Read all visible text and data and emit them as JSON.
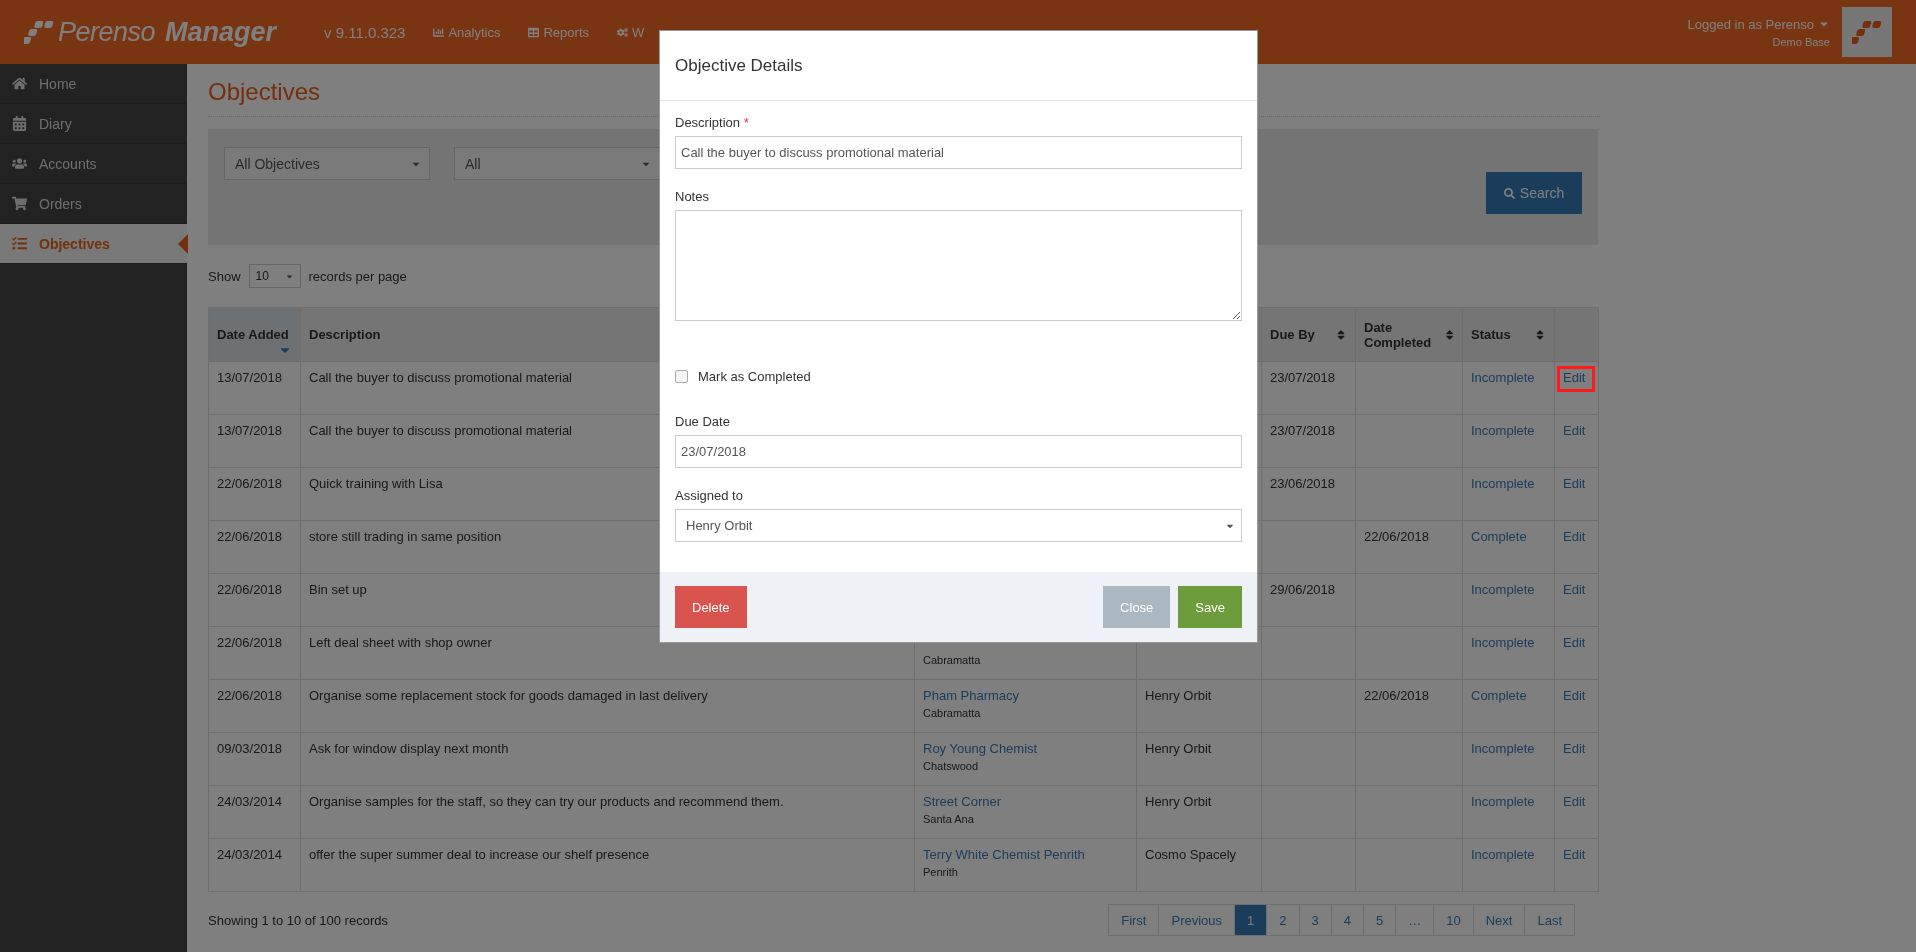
{
  "header": {
    "logo": {
      "brand": "Perenso",
      "product": "Manager"
    },
    "version": "v 9.11.0.323",
    "nav": [
      {
        "label": "Analytics"
      },
      {
        "label": "Reports"
      },
      {
        "label": "W"
      }
    ],
    "user": {
      "logged_in": "Logged in as Perenso",
      "site": "Demo Base"
    }
  },
  "sidebar": {
    "items": [
      {
        "label": "Home",
        "selected": false
      },
      {
        "label": "Diary",
        "selected": false
      },
      {
        "label": "Accounts",
        "selected": false
      },
      {
        "label": "Orders",
        "selected": false
      },
      {
        "label": "Objectives",
        "selected": true
      }
    ]
  },
  "page": {
    "title": "Objectives"
  },
  "filters": {
    "selects": [
      "All Objectives",
      "All"
    ],
    "search_button": "Search"
  },
  "page_size": {
    "prefix": "Show",
    "value": "10",
    "suffix": "records per page"
  },
  "table": {
    "columns": [
      {
        "label": "Date Added",
        "sorted": true,
        "sortable": false
      },
      {
        "label": "Description"
      },
      {
        "label": "Due By",
        "sorted": false,
        "sortable": true
      },
      {
        "label": "Date Completed",
        "sorted": false,
        "sortable": true
      },
      {
        "label": "Status",
        "sorted": false,
        "sortable": true
      }
    ],
    "rows": [
      {
        "date_added": "13/07/2018",
        "description": "Call the buyer to discuss promotional material",
        "due_by": "23/07/2018",
        "status": "Incomplete",
        "action": "Edit",
        "highlighted": true
      },
      {
        "date_added": "13/07/2018",
        "description": "Call the buyer to discuss promotional material",
        "due_by": "23/07/2018",
        "status": "Incomplete",
        "action": "Edit",
        "highlighted": false
      },
      {
        "date_added": "22/06/2018",
        "description": "Quick training with Lisa",
        "due_by": "23/06/2018",
        "status": "Incomplete",
        "action": "Edit",
        "highlighted": false
      },
      {
        "date_added": "22/06/2018",
        "description": "store still trading in same position",
        "date_completed": "22/06/2018",
        "status": "Complete",
        "action": "Edit",
        "highlighted": false
      },
      {
        "date_added": "22/06/2018",
        "description": "Bin set up",
        "due_by": "29/06/2018",
        "status": "Incomplete",
        "action": "Edit",
        "highlighted": false
      },
      {
        "date_added": "22/06/2018",
        "description": "Left deal sheet with shop owner",
        "account": {
          "location": "Cabramatta"
        },
        "status": "Incomplete",
        "action": "Edit",
        "highlighted": false
      },
      {
        "date_added": "22/06/2018",
        "description": "Organise some replacement stock for goods damaged in last delivery",
        "account": {
          "name": "Pham Pharmacy",
          "location": "Cabramatta"
        },
        "assigned_to": "Henry Orbit",
        "date_completed": "22/06/2018",
        "status": "Complete",
        "action": "Edit",
        "highlighted": false
      },
      {
        "date_added": "09/03/2018",
        "description": "Ask for window display next month",
        "account": {
          "name": "Roy Young Chemist",
          "location": "Chatswood"
        },
        "assigned_to": "Henry Orbit",
        "status": "Incomplete",
        "action": "Edit",
        "highlighted": false
      },
      {
        "date_added": "24/03/2014",
        "description": "Organise samples for the staff, so they can try our products and recommend them.",
        "account": {
          "name": "Street Corner",
          "location": "Santa Ana"
        },
        "assigned_to": "Henry Orbit",
        "status": "Incomplete",
        "action": "Edit",
        "highlighted": false
      },
      {
        "date_added": "24/03/2014",
        "description": "offer the super summer deal to increase our shelf presence",
        "account": {
          "name": "Terry White Chemist Penrith",
          "location": "Penrith"
        },
        "assigned_to": "Cosmo Spacely",
        "status": "Incomplete",
        "action": "Edit",
        "highlighted": false
      }
    ]
  },
  "footer": {
    "info": "Showing 1 to 10 of 100 records",
    "pagination": [
      {
        "label": "First",
        "selected": false
      },
      {
        "label": "Previous",
        "selected": false
      },
      {
        "label": "1",
        "selected": true
      },
      {
        "label": "2",
        "selected": false
      },
      {
        "label": "3",
        "selected": false
      },
      {
        "label": "4",
        "selected": false
      },
      {
        "label": "5",
        "selected": false
      },
      {
        "label": "…",
        "selected": false
      },
      {
        "label": "10",
        "selected": false
      },
      {
        "label": "Next",
        "selected": false
      },
      {
        "label": "Last",
        "selected": false
      }
    ]
  },
  "modal": {
    "title": "Objective Details",
    "required_mark": "*",
    "fields": [
      {
        "kind": "text",
        "label": "Description",
        "required": true,
        "value": "Call the buyer to discuss promotional material"
      },
      {
        "kind": "textarea",
        "label": "Notes",
        "required": false
      },
      {
        "kind": "checkbox",
        "label": "Mark as Completed",
        "checked": false
      },
      {
        "kind": "text",
        "label": "Due Date",
        "required": false,
        "value": "23/07/2018"
      },
      {
        "kind": "select",
        "label": "Assigned to",
        "required": false,
        "value": "Henry Orbit"
      }
    ],
    "buttons": [
      {
        "label": "Delete",
        "kind": "danger"
      },
      {
        "label": "Close",
        "kind": "secondary"
      },
      {
        "label": "Save",
        "kind": "primary"
      }
    ]
  }
}
